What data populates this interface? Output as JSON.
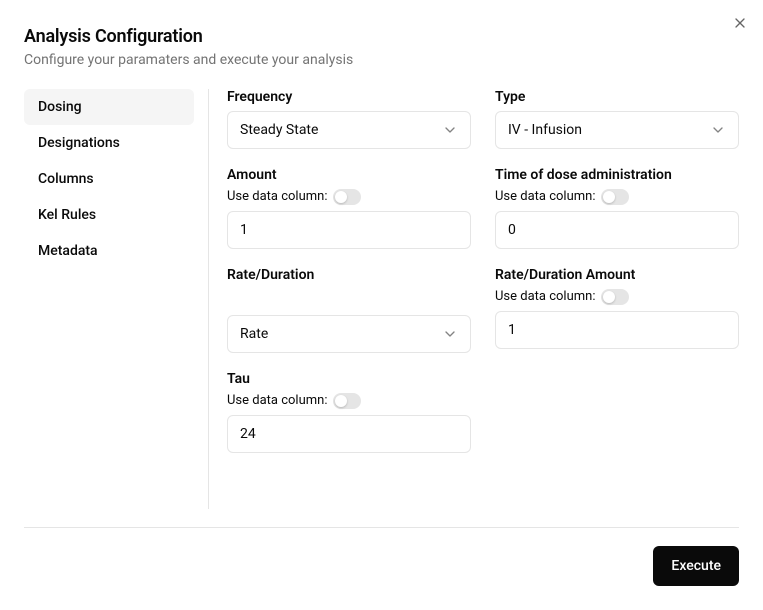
{
  "header": {
    "title": "Analysis Configuration",
    "subtitle": "Configure your paramaters and execute your analysis"
  },
  "sidebar": {
    "items": [
      {
        "label": "Dosing",
        "active": true
      },
      {
        "label": "Designations",
        "active": false
      },
      {
        "label": "Columns",
        "active": false
      },
      {
        "label": "Kel Rules",
        "active": false
      },
      {
        "label": "Metadata",
        "active": false
      }
    ]
  },
  "labels": {
    "use_data_column": "Use data column:"
  },
  "fields": {
    "frequency": {
      "label": "Frequency",
      "value": "Steady State"
    },
    "type": {
      "label": "Type",
      "value": "IV - Infusion"
    },
    "amount": {
      "label": "Amount",
      "value": "1"
    },
    "time_admin": {
      "label": "Time of dose administration",
      "value": "0"
    },
    "rate_duration": {
      "label": "Rate/Duration",
      "value": "Rate"
    },
    "rate_duration_amount": {
      "label": "Rate/Duration Amount",
      "value": "1"
    },
    "tau": {
      "label": "Tau",
      "value": "24"
    }
  },
  "footer": {
    "execute": "Execute"
  }
}
